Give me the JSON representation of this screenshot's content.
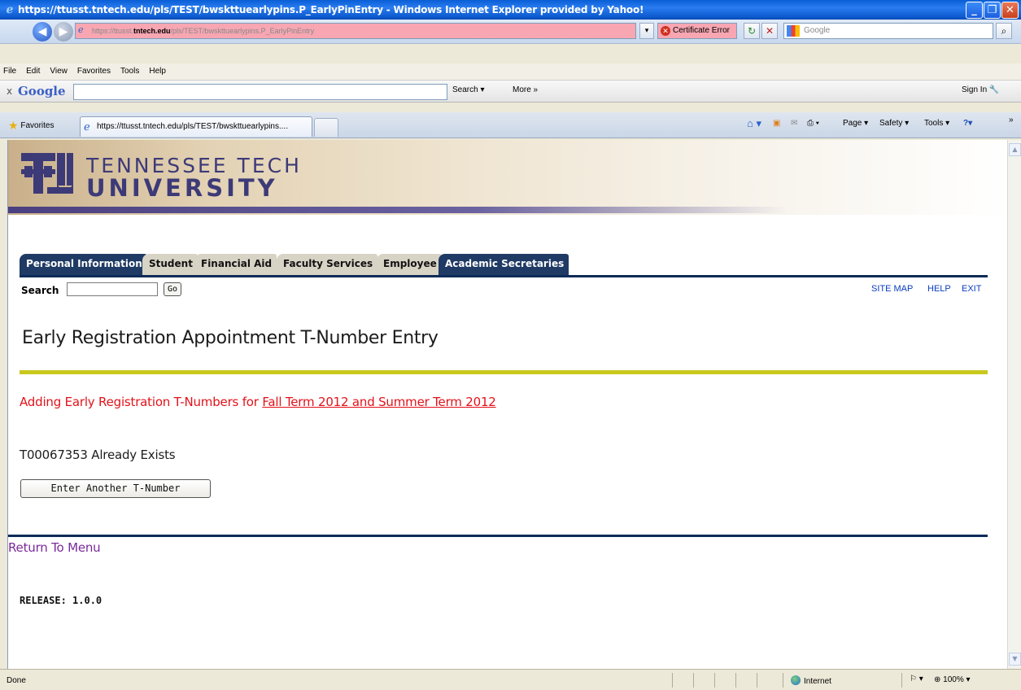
{
  "window": {
    "title": "https://ttusst.tntech.edu/pls/TEST/bwskttuearlypins.P_EarlyPinEntry - Windows Internet Explorer provided by Yahoo!"
  },
  "address_bar": {
    "url_prefix": "https://ttusst.",
    "url_domain": "tntech.edu",
    "url_path": "/pls/TEST/bwskttuearlypins.P_EarlyPinEntry",
    "certificate_error": "Certificate Error",
    "search_placeholder": "Google"
  },
  "menu": [
    "File",
    "Edit",
    "View",
    "Favorites",
    "Tools",
    "Help"
  ],
  "google_toolbar": {
    "close": "x",
    "logo": "Google",
    "search_label": "Search",
    "more_label": "More »",
    "sign_in": "Sign In"
  },
  "favorites_bar": {
    "favorites_label": "Favorites",
    "tab_title": "https://ttusst.tntech.edu/pls/TEST/bwskttuearlypins....",
    "page_label": "Page",
    "safety_label": "Safety",
    "tools_label": "Tools"
  },
  "site": {
    "university_line1": "TENNESSEE TECH",
    "university_line2": "UNIVERSITY",
    "tabs": [
      {
        "label": "Personal Information",
        "active": true
      },
      {
        "label": "Student",
        "active": false
      },
      {
        "label": "Financial Aid",
        "active": false
      },
      {
        "label": "Faculty Services",
        "active": false
      },
      {
        "label": "Employee",
        "active": false
      },
      {
        "label": "Academic Secretaries",
        "active": true
      }
    ],
    "search_label": "Search",
    "go_label": "Go",
    "links": {
      "site_map": "SITE MAP",
      "help": "HELP",
      "exit": "EXIT"
    }
  },
  "page": {
    "title": "Early Registration Appointment T-Number Entry",
    "adding_prefix": "Adding Early Registration T-Numbers for ",
    "adding_terms": "Fall Term 2012 and Summer Term 2012",
    "exists_message": "T00067353 Already Exists",
    "enter_another_button": "Enter Another T-Number",
    "return_link": "Return To Menu",
    "release": "RELEASE: 1.0.0"
  },
  "status_bar": {
    "status": "Done",
    "zone": "Internet",
    "zoom": "100%"
  },
  "colors": {
    "nav_active": "#1f3a64",
    "nav_inactive": "#d7d3c5",
    "accent_red": "#e2121a",
    "divider_yellow": "#c8c81e",
    "return_link": "#7a2a9a"
  }
}
